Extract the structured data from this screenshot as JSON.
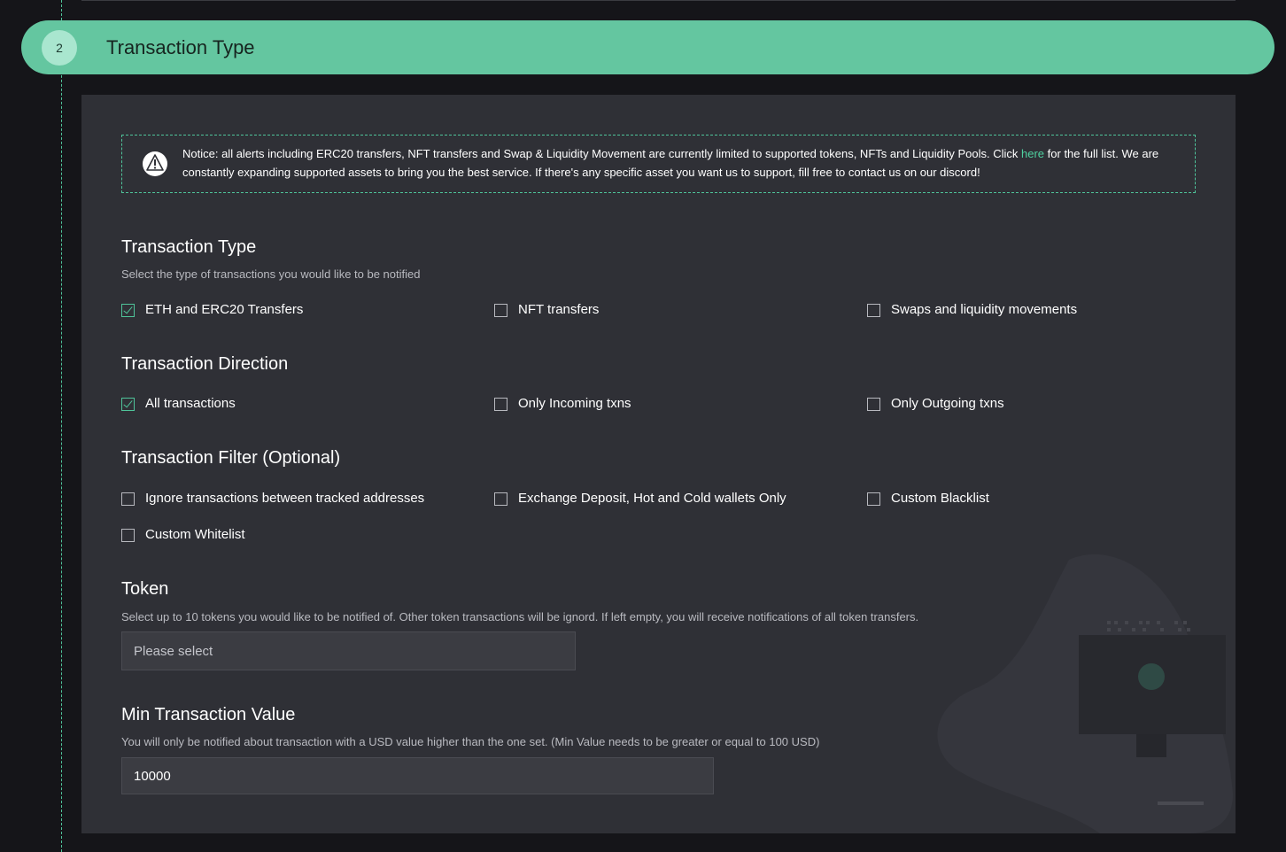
{
  "step": {
    "number": "2",
    "title": "Transaction Type"
  },
  "notice": {
    "icon": "alert-icon",
    "text_before": "Notice: all alerts including ERC20 transfers, NFT transfers and Swap & Liquidity Movement are currently limited to supported tokens, NFTs and Liquidity Pools. Click ",
    "link_text": "here",
    "text_after": " for the full list. We are constantly expanding supported assets to bring you the best service. If there's any specific asset you want us to support, fill free to contact us on our discord!"
  },
  "transaction_type": {
    "title": "Transaction Type",
    "description": "Select the type of transactions you would like to be notified",
    "options": [
      {
        "label": "ETH and ERC20 Transfers",
        "checked": true
      },
      {
        "label": "NFT transfers",
        "checked": false
      },
      {
        "label": "Swaps and liquidity movements",
        "checked": false
      }
    ]
  },
  "transaction_direction": {
    "title": "Transaction Direction",
    "options": [
      {
        "label": "All transactions",
        "checked": true
      },
      {
        "label": "Only Incoming txns",
        "checked": false
      },
      {
        "label": "Only Outgoing txns",
        "checked": false
      }
    ]
  },
  "transaction_filter": {
    "title": "Transaction Filter (Optional)",
    "options": [
      {
        "label": "Ignore transactions between tracked addresses",
        "checked": false
      },
      {
        "label": "Exchange Deposit, Hot and Cold wallets Only",
        "checked": false
      },
      {
        "label": "Custom Blacklist",
        "checked": false
      },
      {
        "label": "Custom Whitelist",
        "checked": false
      }
    ]
  },
  "token": {
    "title": "Token",
    "description": "Select up to 10 tokens you would like to be notified of. Other token transactions will be ignord. If left empty, you will receive notifications of all token transfers.",
    "placeholder": "Please select"
  },
  "min_value": {
    "title": "Min Transaction Value",
    "description": "You will only be notified about transaction with a USD value higher than the one set. (Min Value needs to be greater or equal to 100 USD)",
    "value": "10000"
  },
  "colors": {
    "accent": "#64c6a0",
    "link": "#4fd1a0",
    "panel": "#2f3036",
    "background": "#151519"
  }
}
